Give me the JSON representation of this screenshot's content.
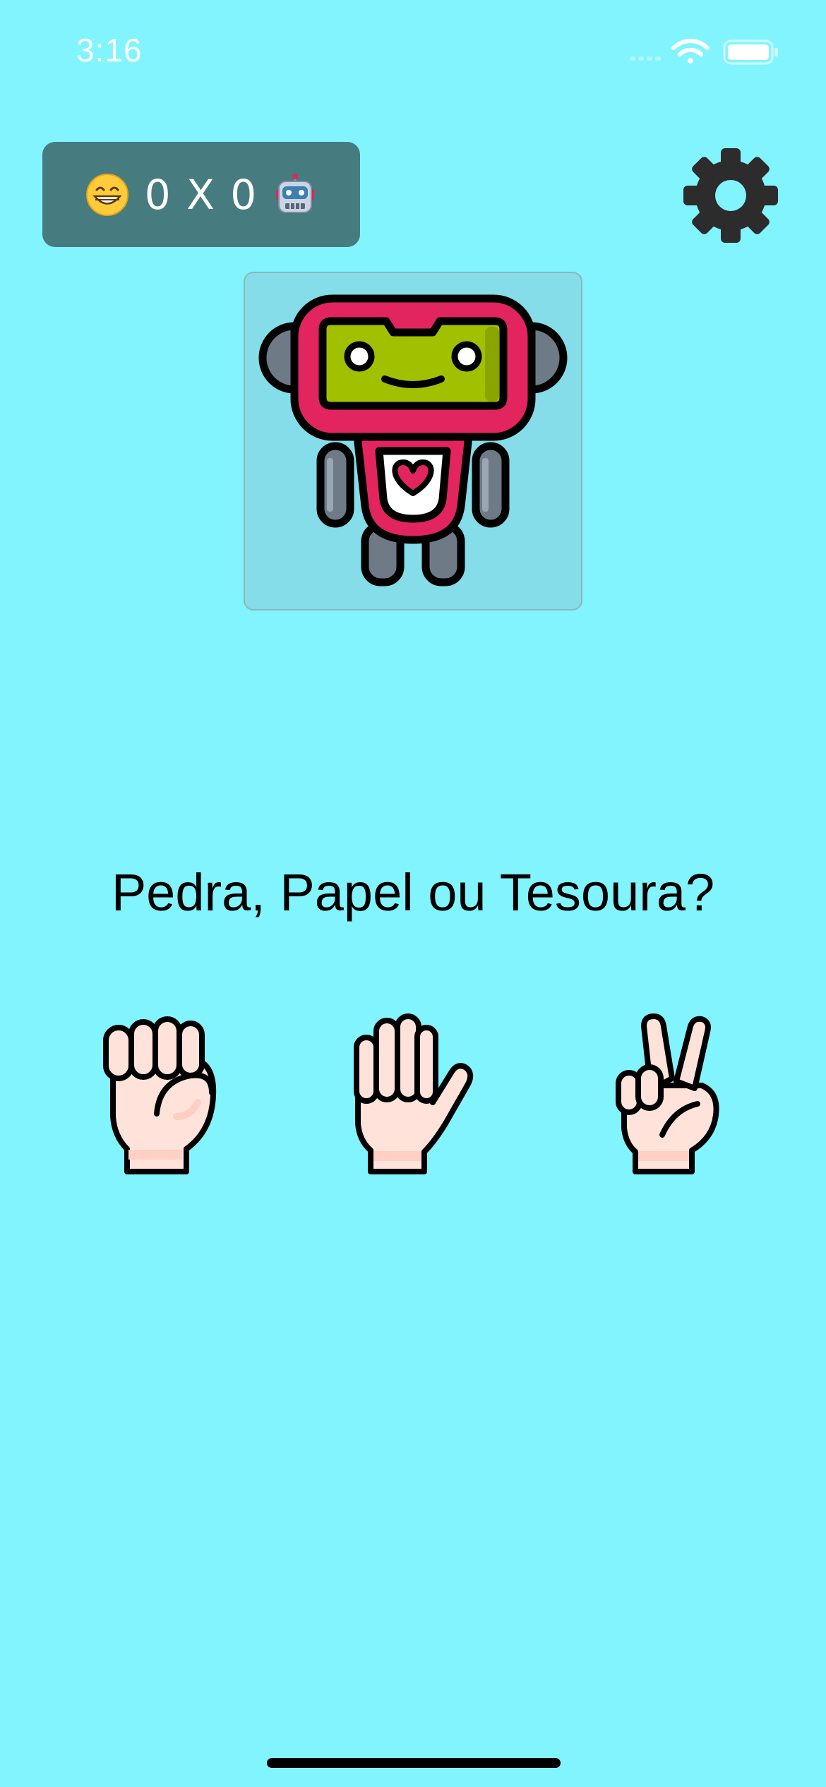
{
  "status_bar": {
    "time": "3:16",
    "icons": [
      "signal-icon",
      "wifi-icon",
      "battery-icon"
    ]
  },
  "scoreboard": {
    "player_icon": "grinning-face-icon",
    "score_text": "0 X 0",
    "opponent_icon": "robot-face-icon"
  },
  "settings": {
    "icon": "gear-icon"
  },
  "opponent": {
    "icon": "robot-icon"
  },
  "prompt": {
    "question": "Pedra, Papel ou Tesoura?"
  },
  "choices": [
    {
      "id": "pedra",
      "icon": "fist-icon"
    },
    {
      "id": "papel",
      "icon": "open-hand-icon"
    },
    {
      "id": "tesoura",
      "icon": "victory-hand-icon"
    }
  ],
  "colors": {
    "background": "#82F4FE",
    "scoreboard": "#467C7F",
    "robot_frame": "#84DDE8",
    "robot_accent": "#E2245F",
    "robot_screen": "#A1C100",
    "skin": "#FFE3DA"
  }
}
